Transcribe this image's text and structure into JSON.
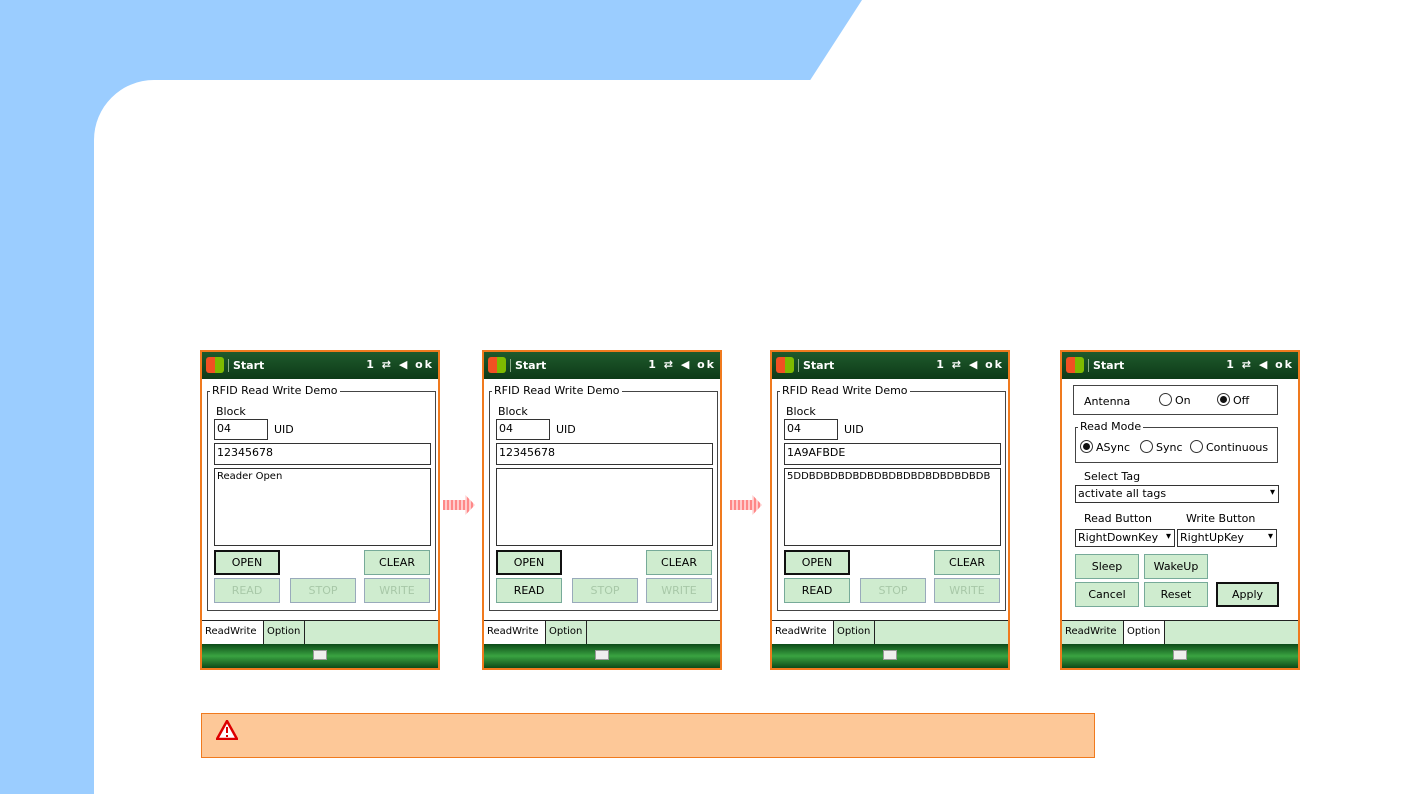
{
  "statusbar": {
    "start": "Start",
    "icons": "1 ⇄ ◀ ok",
    "ok": "ok"
  },
  "rw": {
    "group": "RFID Read Write Demo",
    "block": "Block",
    "uid": "UID",
    "open": "OPEN",
    "clear": "CLEAR",
    "read": "READ",
    "stop": "STOP",
    "write": "WRITE"
  },
  "screens": [
    {
      "block": "04",
      "uid": "12345678",
      "log": "Reader Open",
      "read_enabled": false
    },
    {
      "block": "04",
      "uid": "12345678",
      "log": "",
      "read_enabled": true
    },
    {
      "block": "04",
      "uid": "1A9AFBDE",
      "log": "5DDBDBDBDBDBDBDBDBDBDBDBDBDB",
      "read_enabled": true
    }
  ],
  "tabs": {
    "readwrite": "ReadWrite",
    "option": "Option"
  },
  "option": {
    "antenna": "Antenna",
    "on": "On",
    "off": "Off",
    "antenna_value": "Off",
    "read_mode": "Read Mode",
    "async": "ASync",
    "sync": "Sync",
    "continuous": "Continuous",
    "read_mode_value": "ASync",
    "select_tag": "Select Tag",
    "select_tag_value": "activate all tags",
    "read_button": "Read Button",
    "write_button": "Write Button",
    "read_button_value": "RightDownKey",
    "write_button_value": "RightUpKey",
    "sleep": "Sleep",
    "wakeup": "WakeUp",
    "cancel": "Cancel",
    "reset": "Reset",
    "apply": "Apply"
  },
  "colors": {
    "frame": "#f07a1e",
    "button": "#cfeccf",
    "background": "#9bcdff",
    "warning": "#fdc898"
  }
}
